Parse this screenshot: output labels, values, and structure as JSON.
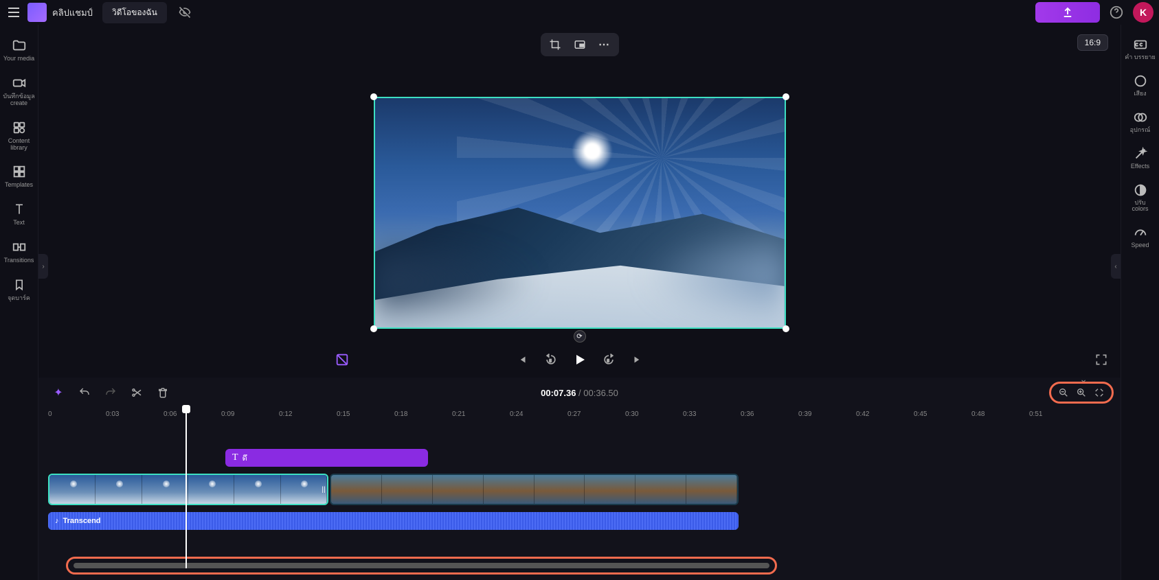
{
  "app": {
    "name": "คลิปแชมป์",
    "tab": "วิดีโอของฉัน"
  },
  "avatar": "K",
  "aspect": "16:9",
  "left_sidebar": [
    {
      "label": "Your media"
    },
    {
      "label": "บันทึกข้อมูล\ncreate"
    },
    {
      "label": "Content library"
    },
    {
      "label": "Templates"
    },
    {
      "label": "Text"
    },
    {
      "label": "Transitions"
    },
    {
      "label": "จุดบาร์ค"
    }
  ],
  "right_sidebar": [
    {
      "label": "คำ บรรยาย"
    },
    {
      "label": "เสียง"
    },
    {
      "label": "อุปกรณ์"
    },
    {
      "label": "Effects"
    },
    {
      "label": "ปรับ\ncolors"
    },
    {
      "label": "Speed"
    }
  ],
  "time": {
    "current": "00:07.36",
    "total": "00:36.50",
    "sep": " / "
  },
  "ruler": [
    "0",
    "0:03",
    "0:06",
    "0:09",
    "0:12",
    "0:15",
    "0:18",
    "0:21",
    "0:24",
    "0:27",
    "0:30",
    "0:33",
    "0:36",
    "0:39",
    "0:42",
    "0:45",
    "0:48",
    "0:51"
  ],
  "clips": {
    "text_label": "ดึ",
    "audio_name": "Transcend"
  }
}
